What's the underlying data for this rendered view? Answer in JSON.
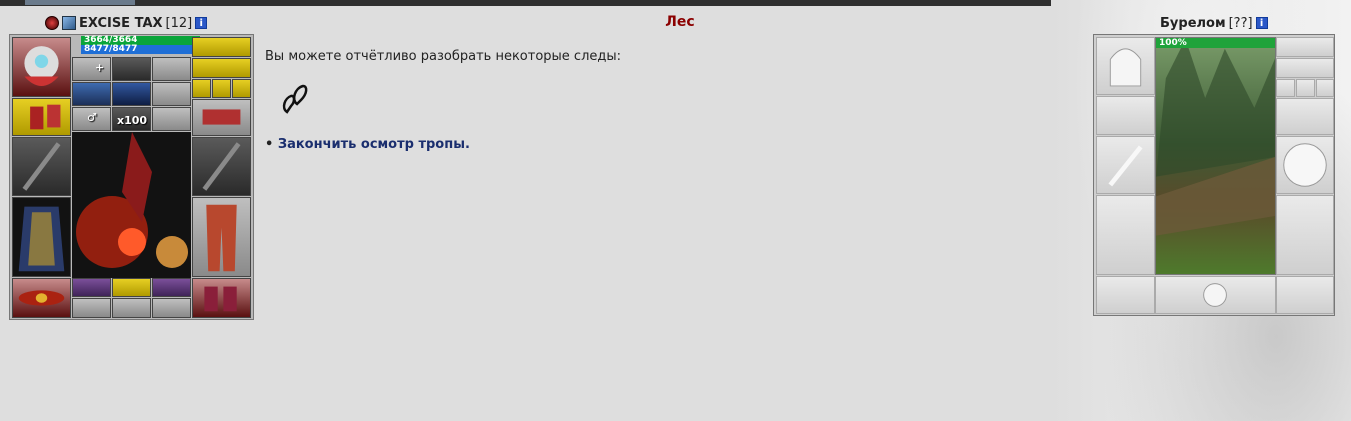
{
  "location_title": "Лес",
  "player": {
    "name": "EXCISE TAX",
    "level": "[12]",
    "info_icon": "i",
    "hp": "3664/3664",
    "mana": "8477/8477",
    "stack_count": "x100"
  },
  "main": {
    "trace_text": "Вы можете отчётливо разобрать некоторые следы:",
    "bullet": "•",
    "finish_link": "Закончить осмотр тропы."
  },
  "opponent": {
    "name": "Бурелом",
    "level": "[??]",
    "info_icon": "i",
    "hp_percent": "100%",
    "hp_fraction": 1.0
  },
  "colors": {
    "location": "#8b0000",
    "link": "#1a2e6e",
    "hp_bar": "#0aa53a",
    "mana_bar": "#1f6fd6"
  }
}
